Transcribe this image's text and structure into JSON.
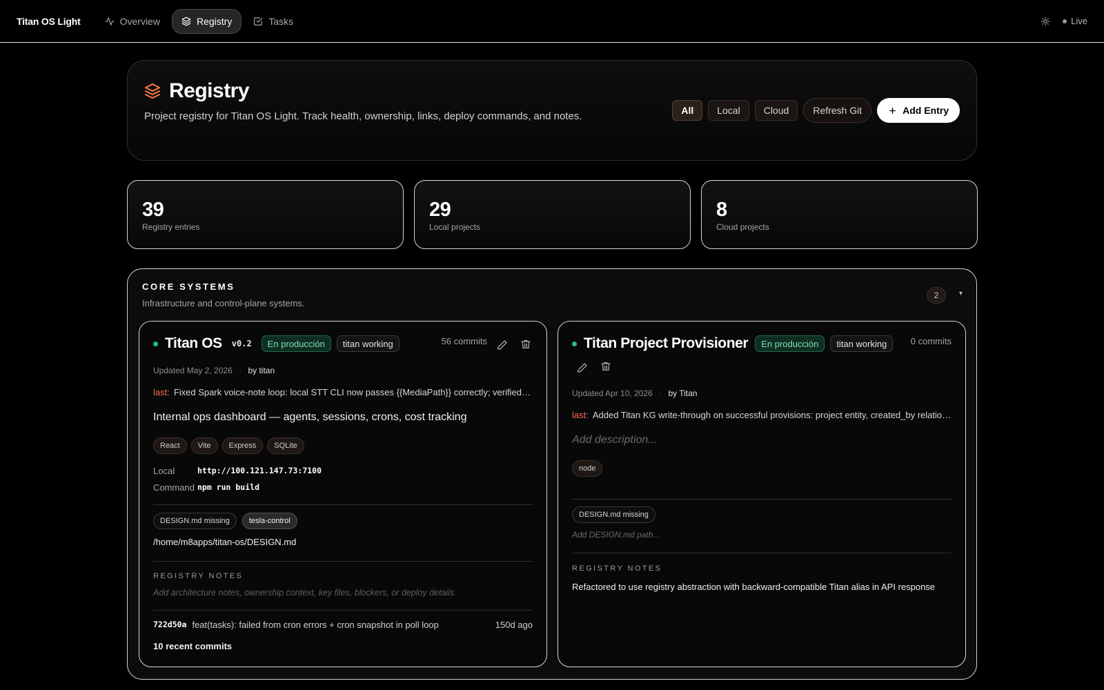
{
  "app": {
    "brand": "Titan OS Light",
    "nav": [
      {
        "label": "Overview",
        "icon": "activity-icon"
      },
      {
        "label": "Registry",
        "icon": "layers-icon"
      },
      {
        "label": "Tasks",
        "icon": "check-square-icon"
      }
    ],
    "theme_icon": "sun-icon",
    "status": "Live"
  },
  "hero": {
    "title": "Registry",
    "description": "Project registry for Titan OS Light. Track health, ownership, links, deploy commands, and notes.",
    "filters": [
      "All",
      "Local",
      "Cloud"
    ],
    "active_filter": "All",
    "refresh_label": "Refresh Git",
    "add_label": "Add Entry",
    "accent_color": "#ff7a45"
  },
  "stats": [
    {
      "value": "39",
      "label": "Registry entries"
    },
    {
      "value": "29",
      "label": "Local projects"
    },
    {
      "value": "8",
      "label": "Cloud projects"
    }
  ],
  "section": {
    "title": "CORE SYSTEMS",
    "subtitle": "Infrastructure and control-plane systems.",
    "count": "2",
    "chevron": "▾"
  },
  "cards": [
    {
      "name": "Titan OS",
      "version": "v0.2",
      "status": "En producción",
      "owner_status": "titan working",
      "commits": "56 commits",
      "updated": "Updated May 2, 2026",
      "by": "by titan",
      "last_label": "last:",
      "last_text": "Fixed Spark voice-note loop: local STT CLI now passes {{MediaPath}} correctly; verified …",
      "description": "Internal ops dashboard — agents, sessions, crons, cost tracking",
      "tags": [
        "React",
        "Vite",
        "Express",
        "SQLite"
      ],
      "local_label": "Local",
      "local_value": "http://100.121.147.73:7100",
      "command_label": "Command",
      "command_value": "npm run build",
      "design_pills": [
        "DESIGN.md missing",
        "tesla-control"
      ],
      "design_path": "/home/m8apps/titan-os/DESIGN.md",
      "notes_label": "REGISTRY NOTES",
      "notes_placeholder": "Add architecture notes, ownership context, key files, blockers, or deploy details",
      "commit_hash": "722d50a",
      "commit_msg": "feat(tasks): failed from cron errors + cron snapshot in poll loop",
      "commit_age": "150d ago",
      "recent_label": "10 recent commits"
    },
    {
      "name": "Titan Project Provisioner",
      "status": "En producción",
      "owner_status": "titan working",
      "commits": "0 commits",
      "updated": "Updated Apr 10, 2026",
      "by": "by Titan",
      "last_label": "last:",
      "last_text": "Added Titan KG write-through on successful provisions: project entity, created_by relatio…",
      "description_placeholder": "Add description...",
      "tags": [
        "node"
      ],
      "design_pills": [
        "DESIGN.md missing"
      ],
      "design_path_placeholder": "Add DESIGN.md path...",
      "notes_label": "REGISTRY NOTES",
      "notes": "Refactored to use registry abstraction with backward-compatible Titan alias in API response"
    }
  ]
}
